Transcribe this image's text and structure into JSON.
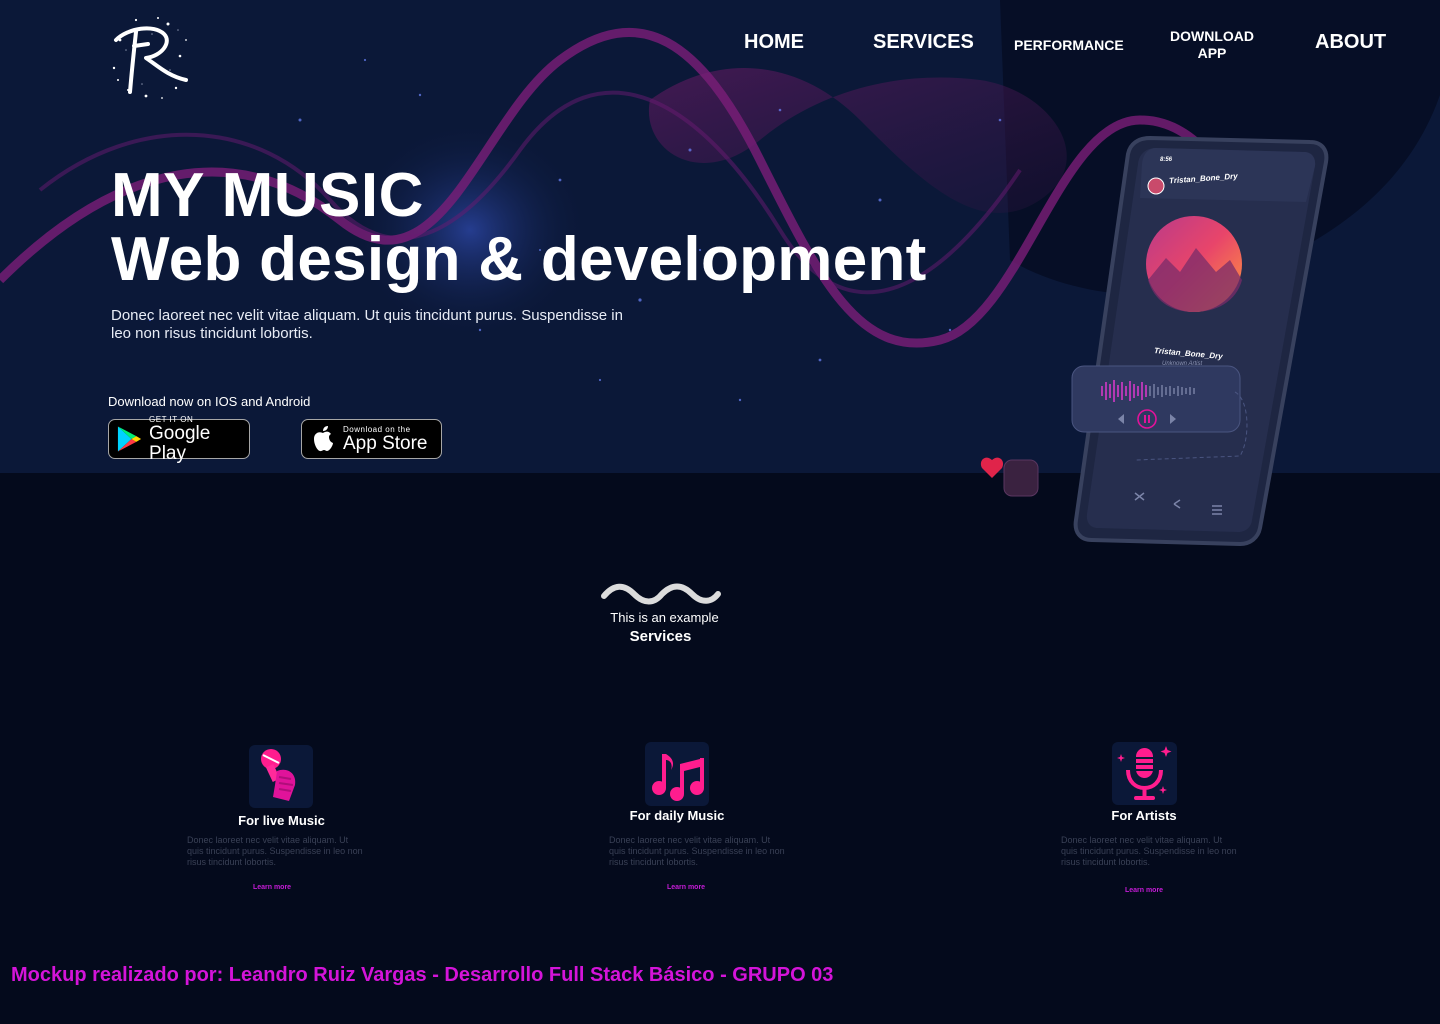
{
  "nav": {
    "items": [
      {
        "label": "HOME"
      },
      {
        "label": "SERVICES"
      },
      {
        "label": "PERFORMANCE"
      },
      {
        "label": "DOWNLOAD APP"
      },
      {
        "label": "ABOUT"
      }
    ]
  },
  "hero": {
    "title_line1": "MY MUSIC",
    "title_line2": "Web design & development",
    "subtitle": "Donec laoreet nec velit vitae aliquam. Ut quis tincidunt purus. Suspendisse in leo non risus tincidunt lobortis.",
    "download_label": "Download now on IOS and Android",
    "google_play": {
      "small": "GET IT ON",
      "big": "Google Play"
    },
    "app_store": {
      "small": "Download on the",
      "big": "App Store"
    }
  },
  "phone": {
    "time": "8:56",
    "song_title": "Tristan_Bone_Dry",
    "artist": "Unknown Artist"
  },
  "services": {
    "eyebrow": "This is an example",
    "title": "Services",
    "cards": [
      {
        "title": "For live Music",
        "description": "Donec laoreet nec velit vitae aliquam. Ut quis tincidunt purus. Suspendisse in leo non risus tincidunt lobortis.",
        "link": "Learn more",
        "icon": "microphone-hand-icon"
      },
      {
        "title": "For daily Music",
        "description": "Donec laoreet nec velit vitae aliquam. Ut quis tincidunt purus. Suspendisse in leo non risus tincidunt lobortis.",
        "link": "Learn more",
        "icon": "music-notes-icon"
      },
      {
        "title": "For Artists",
        "description": "Donec laoreet nec velit vitae aliquam. Ut quis tincidunt purus. Suspendisse in leo non risus tincidunt lobortis.",
        "link": "Learn more",
        "icon": "studio-microphone-icon"
      }
    ]
  },
  "footer": {
    "credit": "Mockup realizado por: Leandro Ruiz Vargas - Desarrollo Full Stack Básico - GRUPO 03"
  },
  "colors": {
    "hero_bg": "#0b1838",
    "page_bg": "#040a1c",
    "accent_pink": "#e0139a",
    "accent_magenta": "#d414d9",
    "wave_purple": "#7a1e78"
  }
}
